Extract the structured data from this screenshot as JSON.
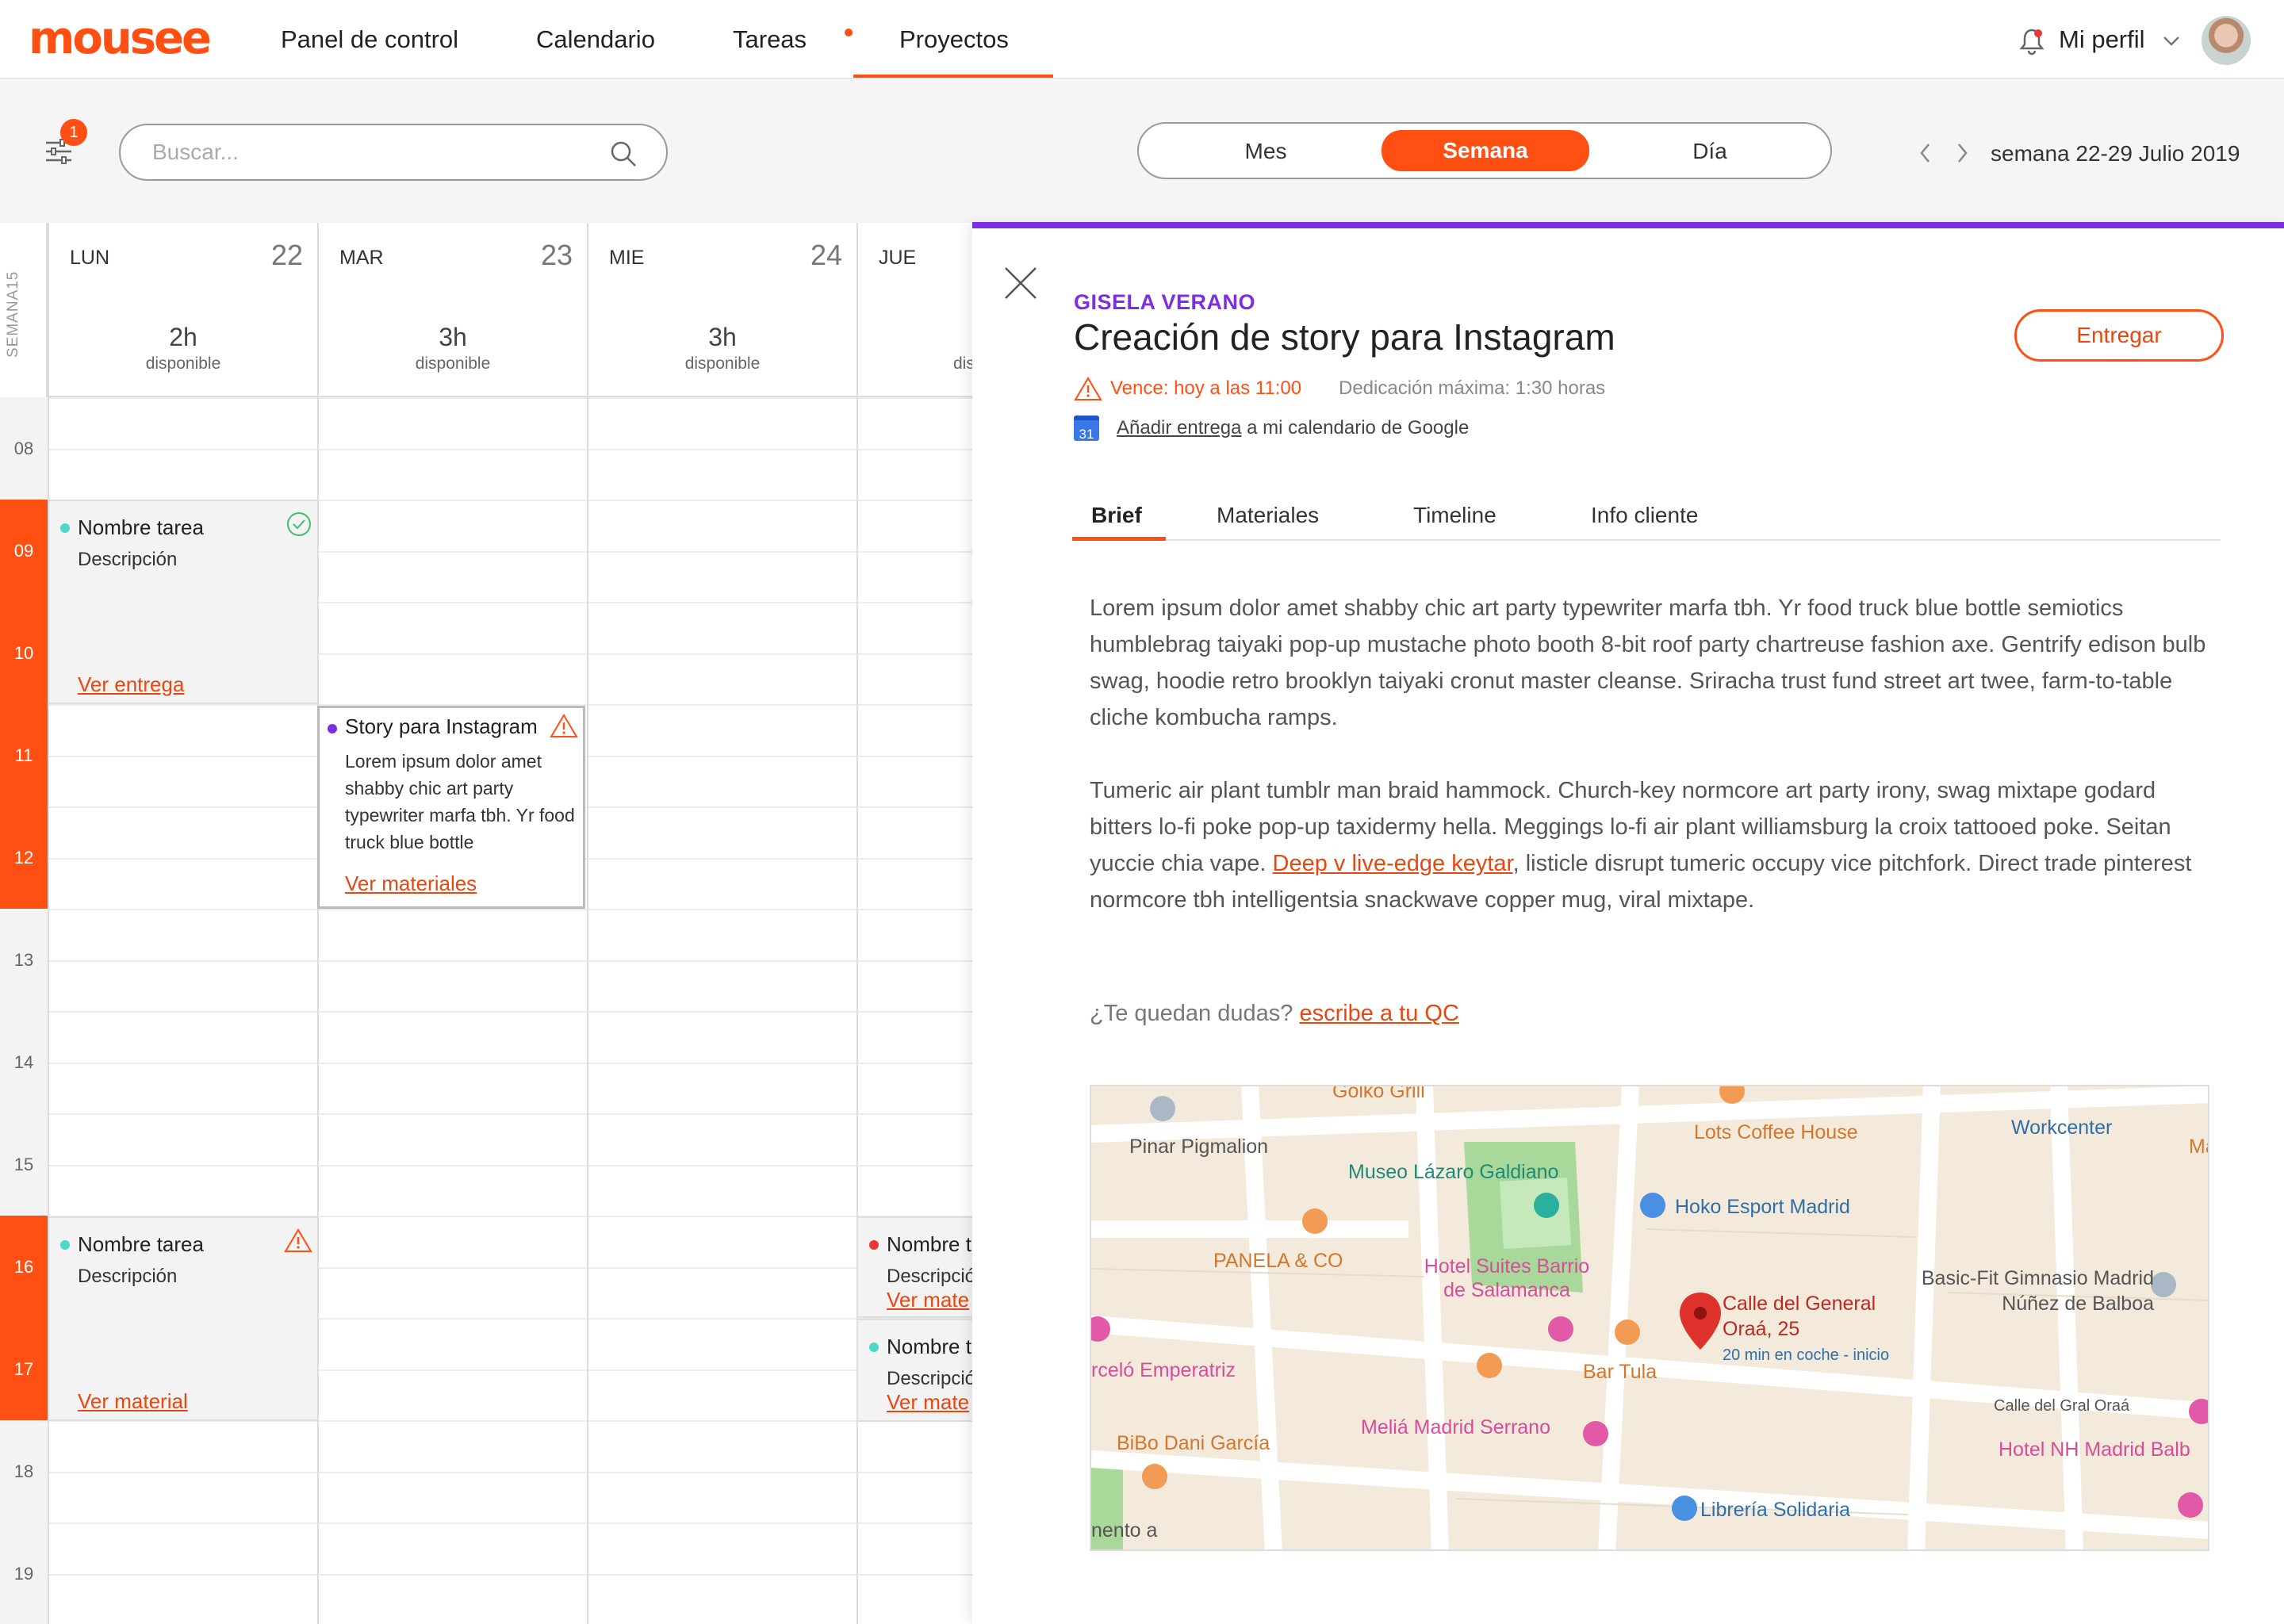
{
  "app": {
    "logo": "mousee"
  },
  "nav": {
    "items": [
      "Panel de control",
      "Calendario",
      "Tareas",
      "Proyectos"
    ],
    "active": "Proyectos",
    "profile": "Mi perfil"
  },
  "toolbar": {
    "filter_badge": "1",
    "search_placeholder": "Buscar...",
    "views": [
      "Mes",
      "Semana",
      "Día"
    ],
    "active_view": "Semana",
    "week_label": "semana 22-29 Julio 2019"
  },
  "calendar": {
    "week_tag": "SEMANA15",
    "hours": [
      "08",
      "09",
      "10",
      "11",
      "12",
      "13",
      "14",
      "15",
      "16",
      "17",
      "18",
      "19"
    ],
    "active_hours": [
      "09",
      "10",
      "11",
      "12",
      "16",
      "17"
    ],
    "days": [
      {
        "name": "LUN",
        "num": "22",
        "hours": "2h",
        "avail": "disponible"
      },
      {
        "name": "MAR",
        "num": "23",
        "hours": "3h",
        "avail": "disponible"
      },
      {
        "name": "MIE",
        "num": "24",
        "hours": "3h",
        "avail": "disponible"
      },
      {
        "name": "JUE",
        "num": "",
        "hours": "",
        "avail": "dis"
      }
    ],
    "events": {
      "lun_1": {
        "title": "Nombre tarea",
        "desc": "Descripción",
        "link": "Ver entrega"
      },
      "lun_2": {
        "title": "Nombre tarea",
        "desc": "Descripción",
        "link": "Ver material"
      },
      "mar_1": {
        "title": "Story para Instagram",
        "desc": "Lorem ipsum dolor amet shabby chic art party typewriter marfa tbh. Yr food truck blue bottle",
        "link": "Ver materiales"
      },
      "jue_1": {
        "title": "Nombre t",
        "desc": "Descripció",
        "link": "Ver mate"
      },
      "jue_2": {
        "title": "Nombre t",
        "desc": "Descripció",
        "link": "Ver mate"
      }
    }
  },
  "panel": {
    "client": "GISELA VERANO",
    "title": "Creación de story para Instagram",
    "deliver_button": "Entregar",
    "due": "Vence: hoy a las 11:00",
    "dedication": "Dedicación máxima: 1:30 horas",
    "gcal_link": "Añadir entrega",
    "gcal_rest": " a mi calendario de Google",
    "gcal_icon_num": "31",
    "tabs": [
      "Brief",
      "Materiales",
      "Timeline",
      "Info cliente"
    ],
    "active_tab": "Brief",
    "paragraph1": "Lorem ipsum dolor amet shabby chic art party typewriter marfa tbh. Yr food truck blue bottle semiotics humblebrag taiyaki pop-up mustache photo booth 8-bit roof party chartreuse fashion axe. Gentrify edison bulb swag, hoodie retro brooklyn taiyaki cronut master cleanse. Sriracha trust fund street art twee, farm-to-table cliche kombucha ramps.",
    "paragraph2_a": "Tumeric air plant tumblr man braid hammock. Church-key normcore art party irony, swag mixtape godard bitters lo-fi poke pop-up taxidermy hella. Meggings lo-fi air plant williamsburg la croix tattooed poke. Seitan yuccie chia vape. ",
    "paragraph2_link": "Deep v live-edge keytar",
    "paragraph2_b": ", listicle disrupt tumeric occupy vice pitchfork. Direct trade pinterest normcore tbh intelligentsia snackwave copper mug, viral mixtape.",
    "doubts_text": "¿Te quedan dudas? ",
    "doubts_link": "escribe a tu QC"
  },
  "map": {
    "labels": {
      "pinar": "Pinar Pigmalion",
      "golko": "Golko Grill",
      "lots": "Lots Coffee House",
      "workcenter": "Workcenter",
      "museo": "Museo Lázaro Galdiano",
      "hoko": "Hoko Esport Madrid",
      "panela": "PANELA & CO",
      "hotel_suites": "Hotel Suites Barrio de Salamanca",
      "basicfit": "Basic-Fit Gimnasio Madrid Núñez de Balboa",
      "address": "Calle del General Oraá, 25",
      "drive": "20 min en coche - inicio",
      "bartula": "Bar Tula",
      "emperatriz": "rceló Emperatriz",
      "gral_oraa": "Calle del Gral Oraá",
      "nh": "Hotel NH Madrid Balb",
      "bibo": "BiBo Dani García",
      "melia": "Meliá Madrid Serrano",
      "libreria": "Librería Solidaria",
      "mento": "nento a",
      "ma": "Ma"
    }
  },
  "colors": {
    "accent": "#ff4f12",
    "purple": "#7b2fe0",
    "teal": "#4fd8c8",
    "red": "#e83838"
  }
}
